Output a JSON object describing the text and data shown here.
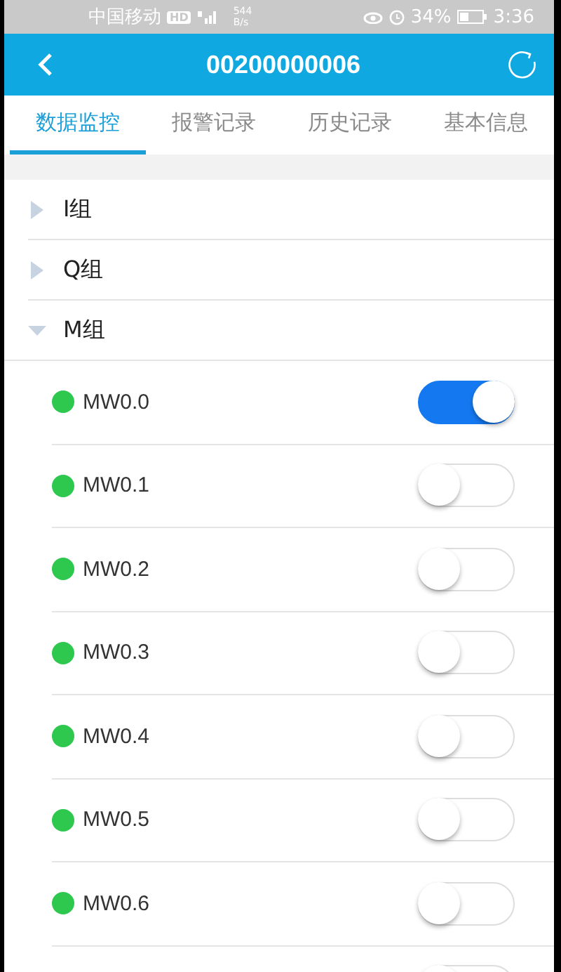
{
  "status_bar": {
    "carrier": "中国移动",
    "hd_badge": "HD",
    "speed": "544\nB/s",
    "battery": "34%",
    "time": "3:36"
  },
  "header": {
    "title": "00200000006"
  },
  "tabs": [
    {
      "label": "数据监控",
      "selected": true
    },
    {
      "label": "报警记录",
      "selected": false
    },
    {
      "label": "历史记录",
      "selected": false
    },
    {
      "label": "基本信息",
      "selected": false
    }
  ],
  "groups": [
    {
      "label": "I组",
      "expanded": false
    },
    {
      "label": "Q组",
      "expanded": false
    },
    {
      "label": "M组",
      "expanded": true,
      "children": [
        {
          "name": "MW0.0",
          "color": "#2dc84d",
          "on": true
        },
        {
          "name": "MW0.1",
          "color": "#2dc84d",
          "on": false
        },
        {
          "name": "MW0.2",
          "color": "#2dc84d",
          "on": false
        },
        {
          "name": "MW0.3",
          "color": "#2dc84d",
          "on": false
        },
        {
          "name": "MW0.4",
          "color": "#2dc84d",
          "on": false
        },
        {
          "name": "MW0.5",
          "color": "#2dc84d",
          "on": false
        },
        {
          "name": "MW0.6",
          "color": "#2dc84d",
          "on": false
        },
        {
          "on": false
        }
      ]
    }
  ]
}
